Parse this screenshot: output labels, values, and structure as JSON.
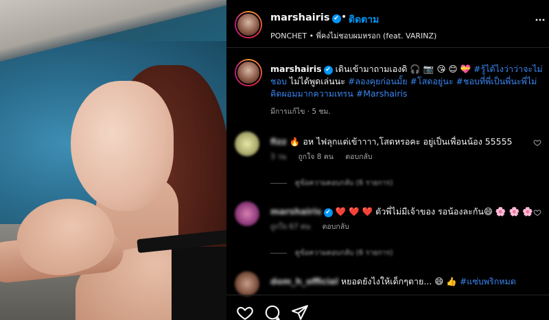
{
  "post_header": {
    "username": "marshairis",
    "verified_mark": "✔",
    "separator": "•",
    "follow_label": "ติดตาม",
    "audio": "PONCHET • พี่คงไม่ชอบผมหรอก (feat. VARINZ)",
    "more_icon": "more-icon"
  },
  "caption": {
    "username": "marshairis",
    "text": "เดินเข้ามาถามเองดิ 🎧 📷 😘 😊 💝",
    "line2_plain": "ไม่ได้พูดเล่นนะ",
    "hashtags_1": "#รู้ได้ไงว่าว่าจะไม่ชอบ",
    "hashtags_2": "#ลองคุยก่อนมั้ย #โสดอยู่นะ #ชอบที่พี่เป็นพี่นะพี่ไม่คิดผอมมากความเทรน #Marshairis",
    "meta": "มีการแก้ไข · 5 ชม."
  },
  "comments": [
    {
      "username": "fizz",
      "text": "🔥 อห ไฟลุกแต่เข้าาาา,โสดหรอคะ อยู่เป็นเพื่อนน้อง 55555",
      "time": "3 วน",
      "likes": "ถูกใจ 8 คน",
      "reply_label": "ตอบกลับ",
      "view_replies": "ดูข้อความตอบกลับ (6 รายการ)"
    },
    {
      "username": "marshairis",
      "text": "❤️ ❤️ ❤️ ตัวพี่ไม่มีเจ้าของ รอน้องละกัน😄 🌸 🌸 🌸",
      "time": "",
      "likes": "ถูกใจ 67 คน",
      "reply_label": "ตอบกลับ",
      "view_replies": "ดูข้อความตอบกลับ (6 รายการ)"
    },
    {
      "username": "dom_h_official",
      "text": "หยอดยังไงให้เด็กๆตาย... 😄 👍",
      "hashtag": "#แซ่บพริกหมด"
    }
  ],
  "actions": {
    "like_icon": "heart-icon",
    "comment_icon": "comment-icon",
    "share_icon": "share-icon"
  },
  "colors": {
    "accent_blue": "#0095f6",
    "hashtag_blue": "#3a86f0",
    "heart_red": "#ed4956",
    "background": "#000000"
  }
}
